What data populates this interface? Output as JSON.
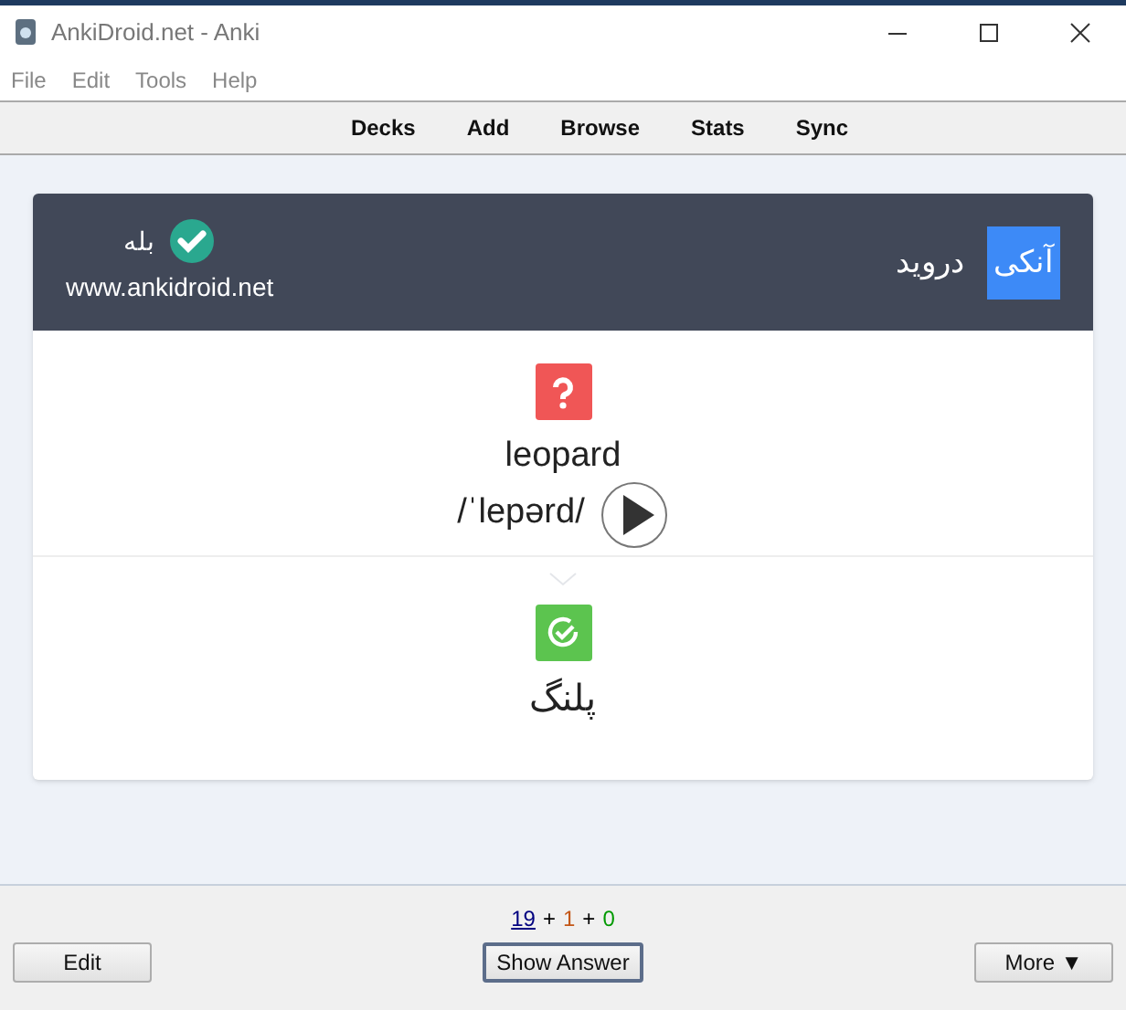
{
  "window": {
    "title": "AnkiDroid.net - Anki"
  },
  "menu": [
    "File",
    "Edit",
    "Tools",
    "Help"
  ],
  "toolbar": [
    "Decks",
    "Add",
    "Browse",
    "Stats",
    "Sync"
  ],
  "card_header": {
    "badge": "آنکی",
    "title": "دروید",
    "logo_text": "بله",
    "url": "www.ankidroid.net"
  },
  "card": {
    "word": "leopard",
    "phonetic": "/ˈlepərd/",
    "answer": "پلنگ"
  },
  "counts": [
    {
      "text": "19",
      "color": "#000080",
      "underline": true
    },
    {
      "text": "+",
      "color": "#000000",
      "underline": false
    },
    {
      "text": "1",
      "color": "#c35617",
      "underline": false
    },
    {
      "text": "+",
      "color": "#000000",
      "underline": false
    },
    {
      "text": "0",
      "color": "#009900",
      "underline": false
    }
  ],
  "buttons": [
    {
      "label": "Edit",
      "kind": "plain"
    },
    {
      "label": "Show Answer",
      "kind": "default"
    },
    {
      "label": "More ▼",
      "kind": "plain"
    }
  ]
}
